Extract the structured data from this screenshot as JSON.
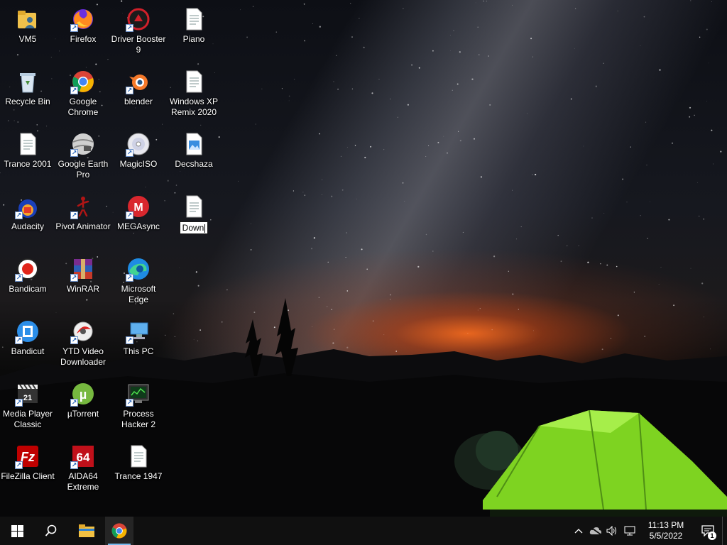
{
  "desktop": {
    "icons": [
      {
        "id": "vm5",
        "label": "VM5",
        "icon": "user-folder-icon"
      },
      {
        "id": "recycle",
        "label": "Recycle Bin",
        "icon": "recycle-bin-icon"
      },
      {
        "id": "trance2001",
        "label": "Trance 2001",
        "icon": "text-document-icon"
      },
      {
        "id": "audacity",
        "label": "Audacity",
        "icon": "audacity-icon"
      },
      {
        "id": "bandicam",
        "label": "Bandicam",
        "icon": "bandicam-icon"
      },
      {
        "id": "bandicut",
        "label": "Bandicut",
        "icon": "bandicut-icon"
      },
      {
        "id": "mpc",
        "label": "Media Player Classic",
        "icon": "media-player-classic-icon"
      },
      {
        "id": "filezilla",
        "label": "FileZilla Client",
        "icon": "filezilla-icon"
      },
      {
        "id": "firefox",
        "label": "Firefox",
        "icon": "firefox-icon"
      },
      {
        "id": "chrome",
        "label": "Google Chrome",
        "icon": "chrome-icon"
      },
      {
        "id": "earth",
        "label": "Google Earth Pro",
        "icon": "google-earth-icon"
      },
      {
        "id": "pivot",
        "label": "Pivot Animator",
        "icon": "pivot-animator-icon"
      },
      {
        "id": "winrar",
        "label": "WinRAR",
        "icon": "winrar-icon"
      },
      {
        "id": "ytd",
        "label": "YTD Video Downloader",
        "icon": "ytd-downloader-icon"
      },
      {
        "id": "utorrent",
        "label": "µTorrent",
        "icon": "utorrent-icon"
      },
      {
        "id": "aida64",
        "label": "AIDA64 Extreme",
        "icon": "aida64-icon"
      },
      {
        "id": "driverbooster",
        "label": "Driver Booster 9",
        "icon": "driver-booster-icon"
      },
      {
        "id": "blender",
        "label": "blender",
        "icon": "blender-icon"
      },
      {
        "id": "magiciso",
        "label": "MagicISO",
        "icon": "disc-icon"
      },
      {
        "id": "megasync",
        "label": "MEGAsync",
        "icon": "mega-icon"
      },
      {
        "id": "edge",
        "label": "Microsoft Edge",
        "icon": "edge-icon"
      },
      {
        "id": "thispc",
        "label": "This PC",
        "icon": "computer-icon"
      },
      {
        "id": "processhacker",
        "label": "Process Hacker 2",
        "icon": "process-hacker-icon"
      },
      {
        "id": "trance1947",
        "label": "Trance 1947",
        "icon": "text-document-icon"
      },
      {
        "id": "piano",
        "label": "Piano",
        "icon": "text-document-icon"
      },
      {
        "id": "winxp",
        "label": "Windows XP Remix 2020",
        "icon": "text-document-icon"
      },
      {
        "id": "decshaza",
        "label": "Decshaza",
        "icon": "image-document-icon"
      }
    ],
    "renaming": {
      "id": "rename",
      "value": "Down",
      "icon": "text-document-icon"
    }
  },
  "taskbar": {
    "start_icon": "windows-start-icon",
    "search_icon": "search-icon",
    "pinned": [
      {
        "name": "file-explorer",
        "icon": "folder-icon",
        "active": false
      },
      {
        "name": "chrome",
        "icon": "chrome-icon",
        "active": true
      }
    ],
    "clock": {
      "time": "11:13 PM",
      "date": "5/5/2022"
    },
    "notifications_count": "1"
  },
  "colors": {
    "taskbar": "#101010",
    "accent": "#76b9ed",
    "tent": "#8be02a"
  }
}
